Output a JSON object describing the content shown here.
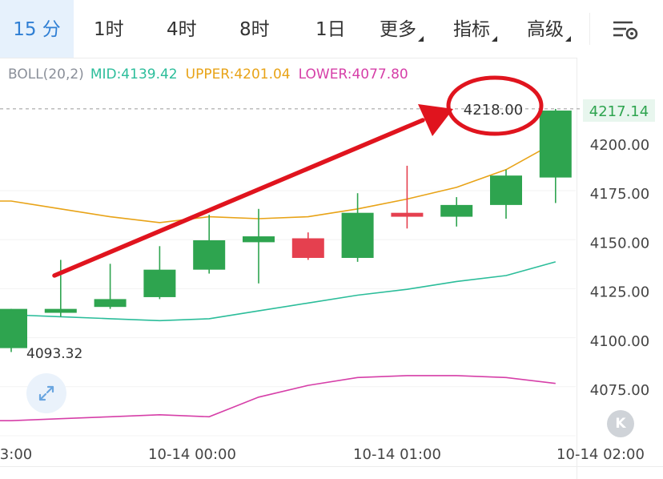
{
  "timeframes": {
    "tabs": [
      {
        "label": "15 分",
        "active": true
      },
      {
        "label": "1时"
      },
      {
        "label": "4时"
      },
      {
        "label": "8时"
      },
      {
        "label": "1日"
      },
      {
        "label": "更多",
        "dropdown": true
      },
      {
        "label": "指标",
        "dropdown": true
      },
      {
        "label": "高级",
        "dropdown": true
      }
    ],
    "settings_icon": "chart-settings-icon"
  },
  "indicator": {
    "name": "BOLL(20,2)",
    "mid_label": "MID:4139.42",
    "upper_label": "UPPER:4201.04",
    "lower_label": "LOWER:4077.80"
  },
  "colors": {
    "up": "#2ea44f",
    "down": "#e5404f",
    "mid": "#2bbd9a",
    "upper": "#e8a317",
    "lower": "#d63fa8",
    "annotation": "#e0141e",
    "active_tab": "#2f7fd4"
  },
  "annotation": {
    "price_label": "4218.00",
    "note": "red arrow pointing up to circled price line"
  },
  "controls": {
    "zoom_icon": "expand-icon",
    "back_label": "K"
  },
  "chart_data": {
    "type": "candlestick",
    "y_ticks": [
      "4200.00",
      "4175.00",
      "4150.00",
      "4125.00",
      "4100.00",
      "4075.00"
    ],
    "y_tick_values": [
      4200,
      4175,
      4150,
      4125,
      4100,
      4075
    ],
    "x_ticks": [
      "3:00",
      "10-14 00:00",
      "10-14 01:00",
      "10-14 02:00"
    ],
    "last_price": "4217.14",
    "dashed_price": 4218.0,
    "low_marker": "4093.32",
    "candles": [
      {
        "o": 4096,
        "h": 4116,
        "l": 4094,
        "c": 4116
      },
      {
        "o": 4114,
        "h": 4141,
        "l": 4112,
        "c": 4116
      },
      {
        "o": 4117,
        "h": 4139,
        "l": 4116,
        "c": 4121
      },
      {
        "o": 4122,
        "h": 4148,
        "l": 4121,
        "c": 4136
      },
      {
        "o": 4136,
        "h": 4164,
        "l": 4134,
        "c": 4151
      },
      {
        "o": 4150,
        "h": 4167,
        "l": 4129,
        "c": 4153
      },
      {
        "o": 4152,
        "h": 4155,
        "l": 4141,
        "c": 4142
      },
      {
        "o": 4142,
        "h": 4175,
        "l": 4140,
        "c": 4165
      },
      {
        "o": 4165,
        "h": 4189,
        "l": 4157,
        "c": 4163
      },
      {
        "o": 4163,
        "h": 4173,
        "l": 4158,
        "c": 4169
      },
      {
        "o": 4169,
        "h": 4187,
        "l": 4162,
        "c": 4184
      },
      {
        "o": 4183,
        "h": 4218,
        "l": 4170,
        "c": 4217.14
      }
    ],
    "boll_upper": [
      4171,
      4167,
      4163,
      4160,
      4163,
      4162,
      4163,
      4167,
      4172,
      4178,
      4187,
      4201
    ],
    "boll_mid": [
      4113,
      4112,
      4111,
      4110,
      4111,
      4115,
      4119,
      4123,
      4126,
      4130,
      4133,
      4140
    ],
    "boll_lower": [
      4059,
      4060,
      4061,
      4062,
      4061,
      4071,
      4077,
      4081,
      4082,
      4082,
      4081,
      4078
    ]
  }
}
